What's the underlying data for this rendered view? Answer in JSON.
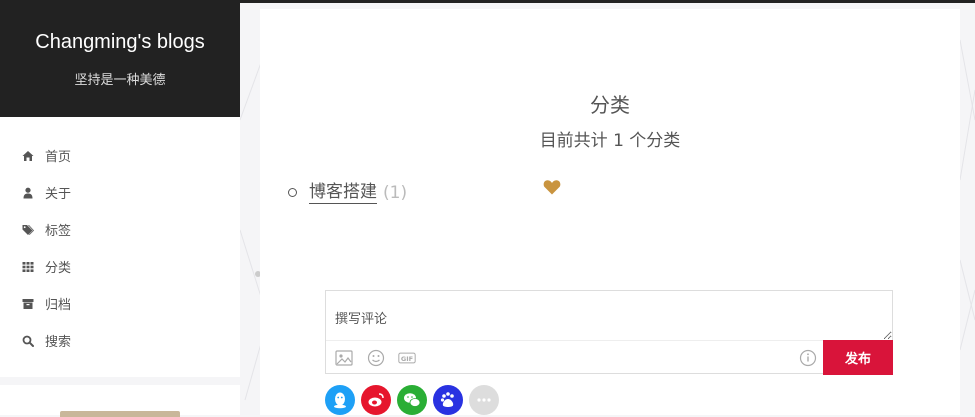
{
  "site": {
    "title": "Changming's blogs",
    "subtitle": "坚持是一种美德"
  },
  "menu": [
    {
      "label": "首页",
      "icon": "home-icon"
    },
    {
      "label": "关于",
      "icon": "user-icon"
    },
    {
      "label": "标签",
      "icon": "tags-icon"
    },
    {
      "label": "分类",
      "icon": "th-icon"
    },
    {
      "label": "归档",
      "icon": "archive-icon"
    },
    {
      "label": "搜索",
      "icon": "search-icon"
    }
  ],
  "page": {
    "title": "分类",
    "summary": "目前共计 1 个分类"
  },
  "categories": [
    {
      "name": "博客搭建",
      "count": "(1)"
    }
  ],
  "comment": {
    "placeholder": "撰写评论",
    "submit_label": "发布",
    "gif_label": "GIF"
  },
  "socials": [
    {
      "icon": "qq-icon",
      "color": "#1ea0f6"
    },
    {
      "icon": "weibo-icon",
      "color": "#e6162d"
    },
    {
      "icon": "wechat-icon",
      "color": "#2aae35"
    },
    {
      "icon": "baidu-icon",
      "color": "#2932e1"
    },
    {
      "icon": "more-icon",
      "color": "#dddddd"
    }
  ],
  "colors": {
    "sidebar_bg": "#222222",
    "submit_bg": "#d9143a",
    "heart": "#c9943f"
  }
}
